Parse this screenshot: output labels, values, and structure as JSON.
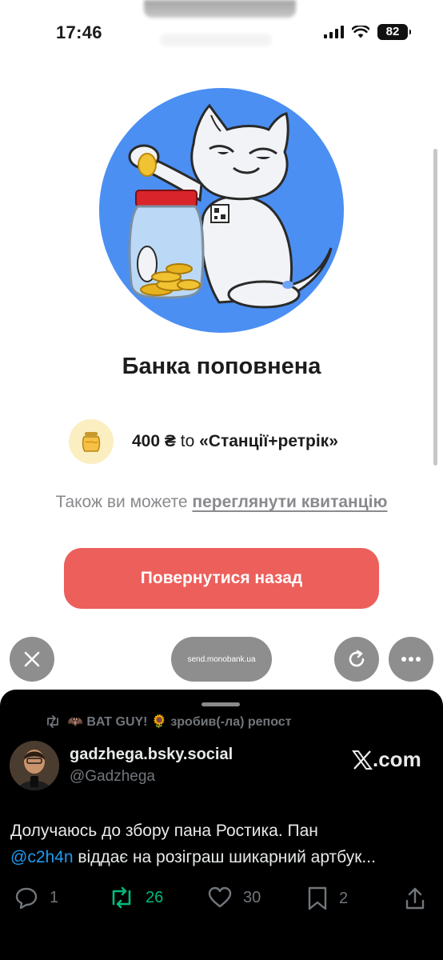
{
  "status_bar": {
    "time": "17:46",
    "battery": "82",
    "icons": [
      "signal-icon",
      "wifi-icon",
      "battery-icon"
    ]
  },
  "success": {
    "title": "Банка поповнена",
    "amount": "400 ₴",
    "to_word": "to",
    "jar_name": "«Станції+ретрік»",
    "receipt_prefix": "Також ви можете",
    "receipt_link": "переглянути квитанцію",
    "back_button": "Повернутися назад"
  },
  "browser": {
    "url": "send.monobank.ua",
    "icons": [
      "close-icon",
      "reload-icon",
      "more-icon"
    ]
  },
  "post": {
    "repost_text": "🦇 BAT GUY! 🌻 зробив(-ла) репост",
    "display_name": "gadzhega.bsky.social",
    "username": "@Gadzhega",
    "source": ".com",
    "text_before": "Долучаюсь до збору пана Ростика. Пан",
    "mention": "@c2h4n",
    "text_after": "віддає на розіграш шикарний артбук...",
    "replies": "1",
    "reposts": "26",
    "likes": "30",
    "bookmarks": "2"
  },
  "colors": {
    "accent_red": "#ec5f5b",
    "hero_blue": "#4b8ff2",
    "link_gray": "#8a8a8e",
    "mention_blue": "#1d9bf0",
    "repost_green": "#00ba7c"
  }
}
